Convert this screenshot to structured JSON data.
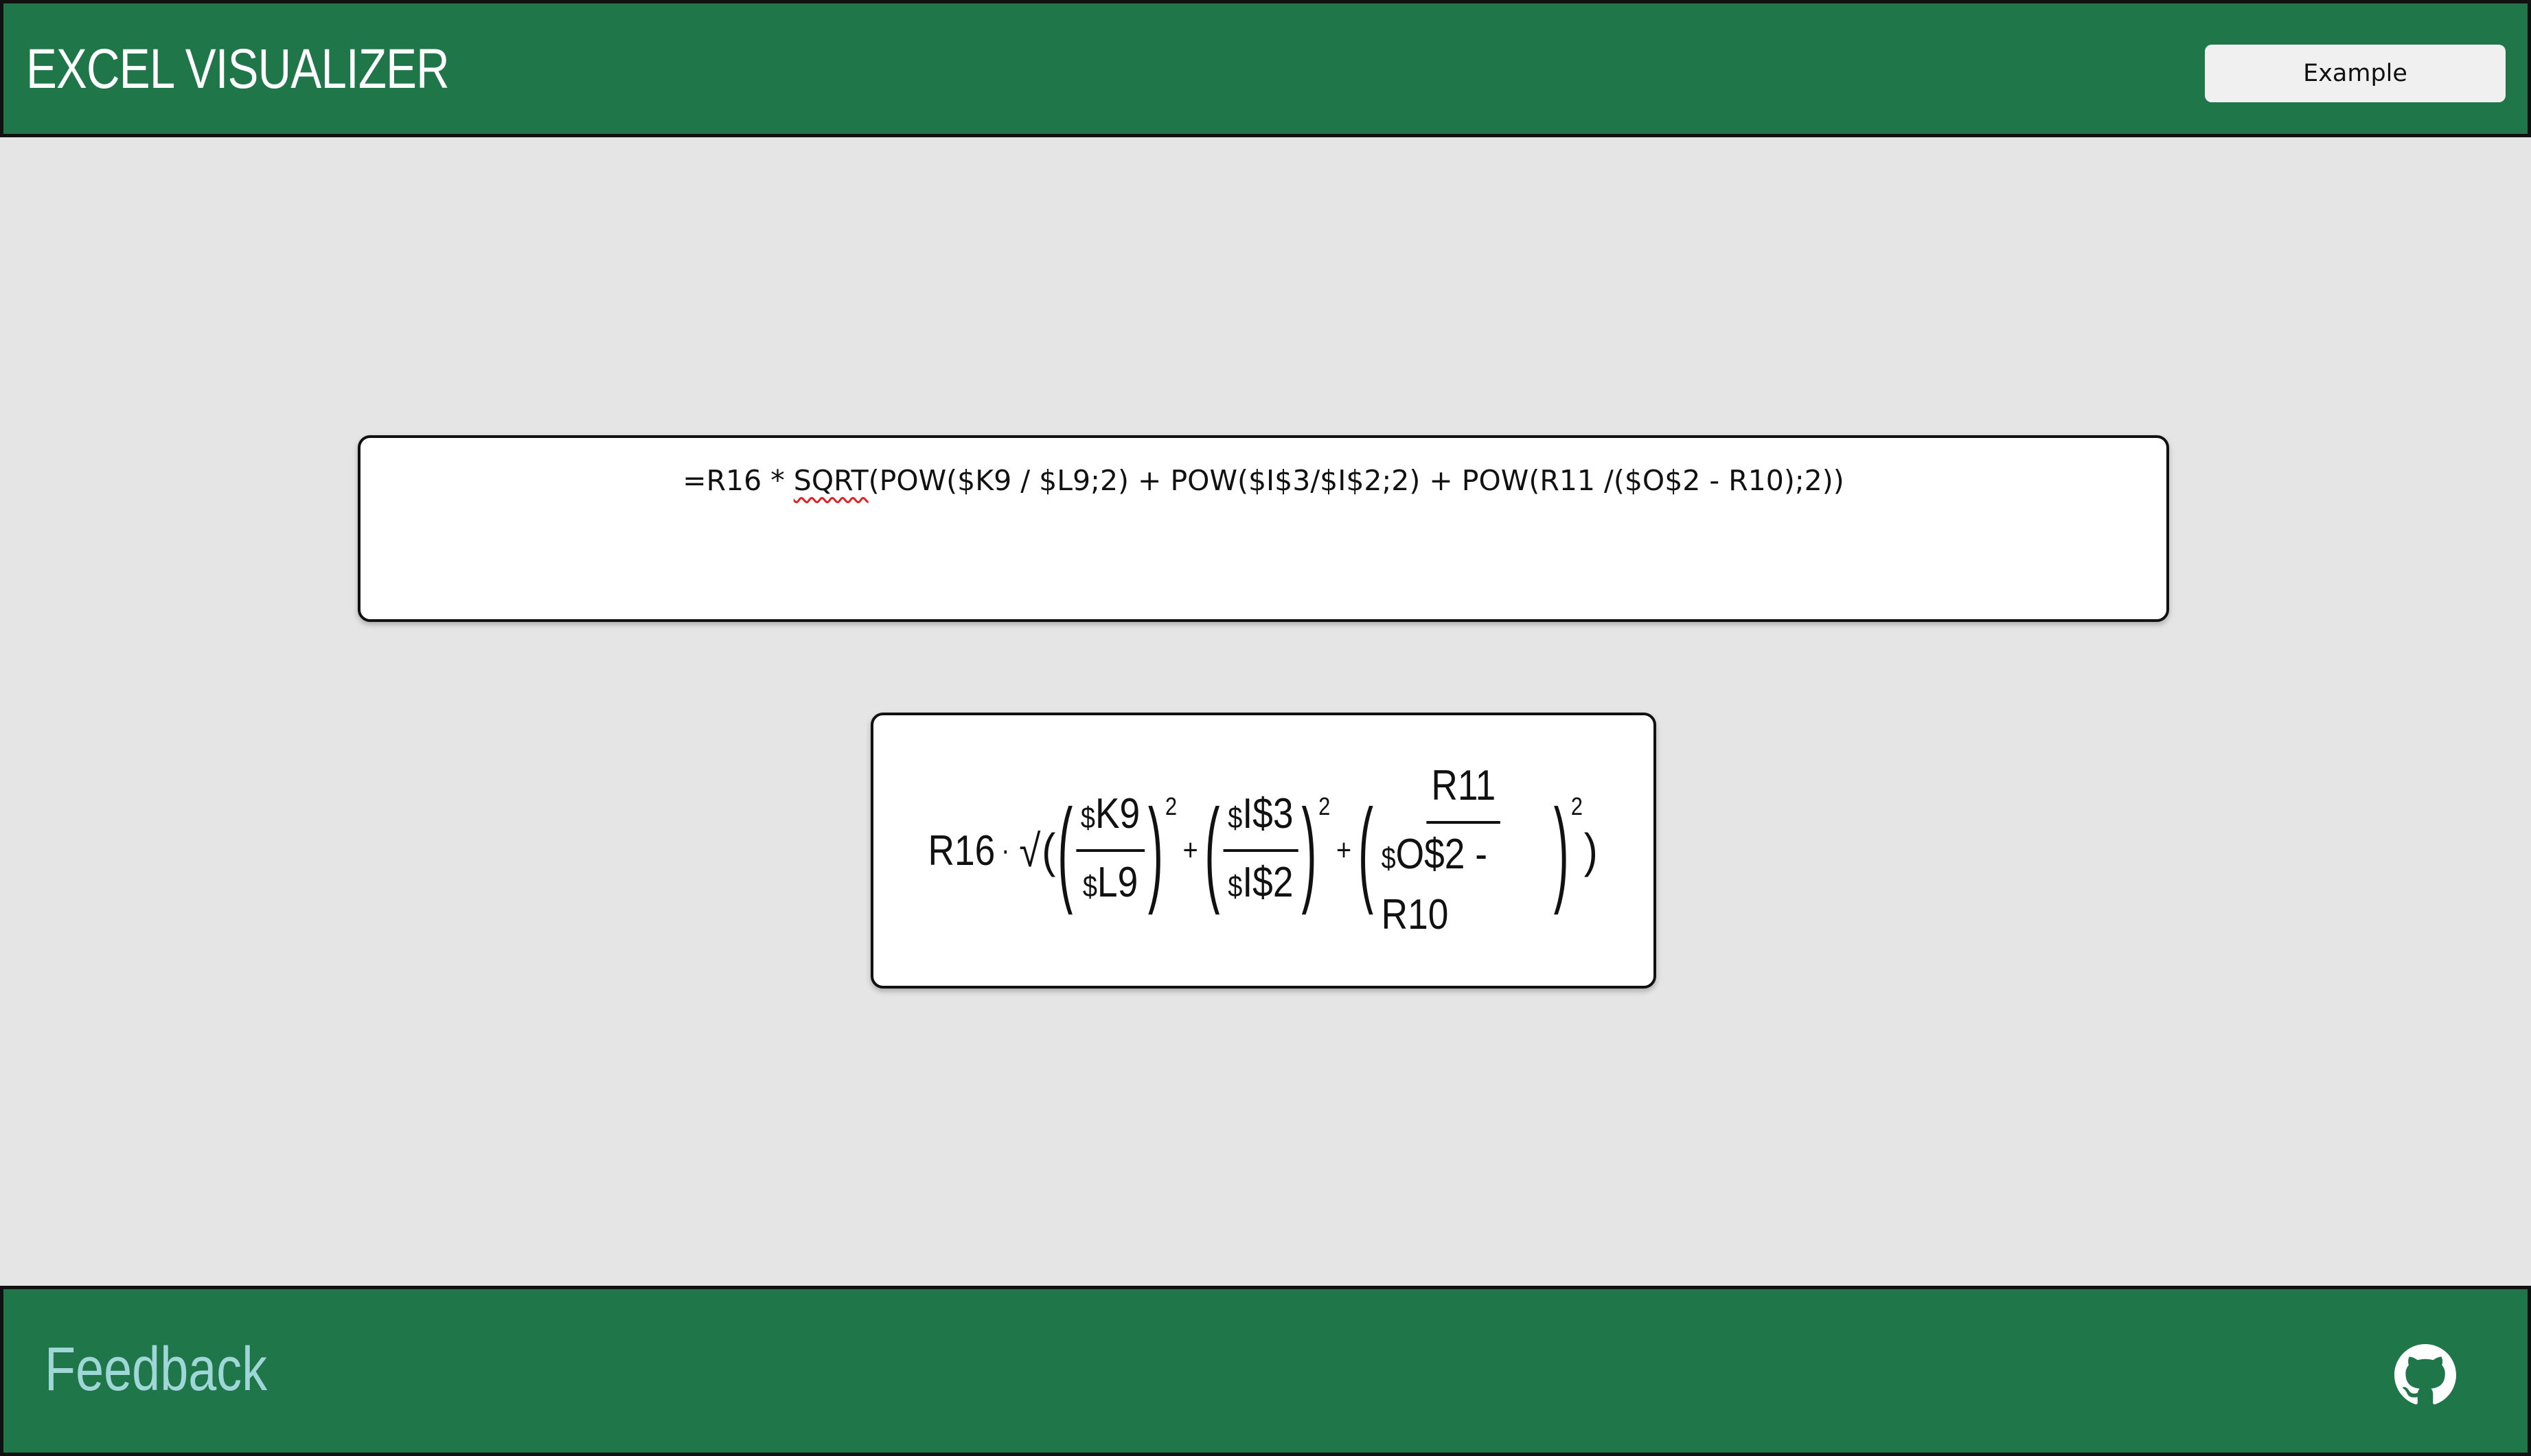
{
  "header": {
    "title": "EXCEL VISUALIZER",
    "example_label": "Example"
  },
  "input": {
    "formula": "=R16 * SQRT(POW($K9 / $L9;2) + POW($I$3/$I$2;2) + POW(R11 /($O$2 - R10);2))",
    "formula_before_spell": "=R16 * ",
    "formula_spell_word": "SQRT",
    "formula_after_spell": "(POW($K9 / $L9;2) + POW($I$3/$I$2;2) + POW(R11 /($O$2 - R10);2))"
  },
  "preview": {
    "lead": "R16",
    "dot": "·",
    "sqrt": "√",
    "open": "(",
    "close": ")",
    "terms": [
      {
        "num": "K9",
        "den": "L9",
        "exp": "2",
        "num_prefix": "$",
        "den_prefix": "$"
      },
      {
        "num": "I$3",
        "den": "I$2",
        "exp": "2",
        "num_prefix": "$",
        "den_prefix": "$"
      },
      {
        "num": "R11",
        "den": "O$2 - R10",
        "exp": "2",
        "num_prefix": "",
        "den_prefix": "$"
      }
    ],
    "plus": "+"
  },
  "footer": {
    "feedback_label": "Feedback",
    "github_icon": "github-icon"
  },
  "colors": {
    "primary": "#1e7649",
    "background": "#e5e5e5",
    "feedback": "#9fd6d8"
  }
}
